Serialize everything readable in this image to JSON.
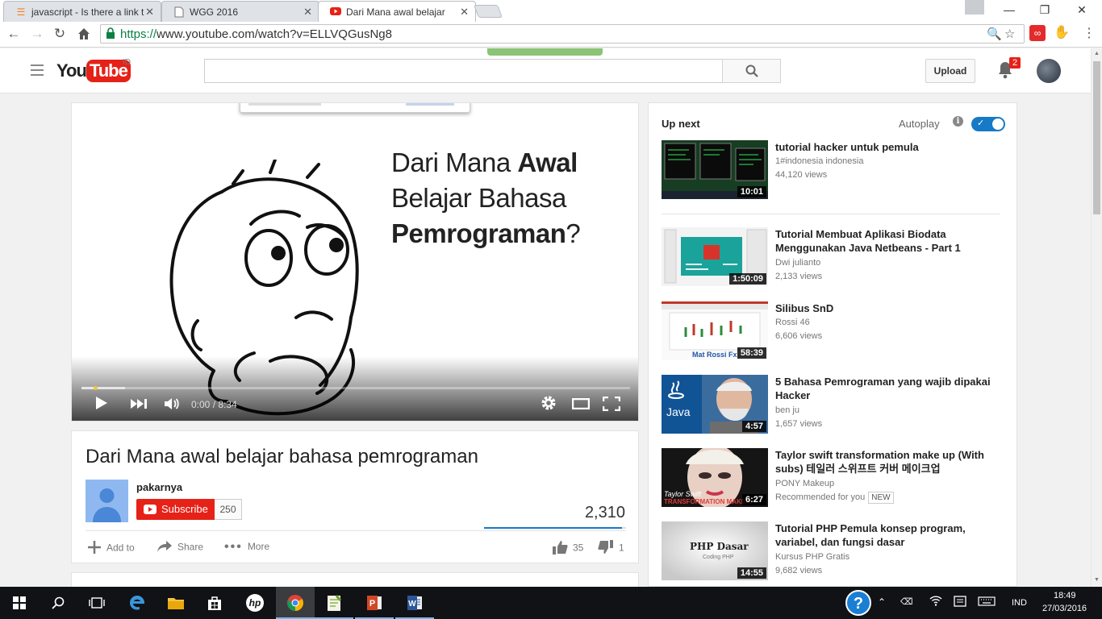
{
  "browser": {
    "tabs": [
      {
        "title": "javascript - Is there a link t",
        "icon": "stackoverflow-icon",
        "active": false
      },
      {
        "title": "WGG 2016",
        "icon": "document-icon",
        "active": false
      },
      {
        "title": "Dari Mana awal belajar",
        "icon": "youtube-icon",
        "active": true
      }
    ],
    "url_scheme": "https://",
    "url_rest": "www.youtube.com/watch?v=ELLVQGusNg8"
  },
  "yt_header": {
    "logo_you": "You",
    "logo_tube": "Tube",
    "region": "ID",
    "search_value": "",
    "upload_label": "Upload",
    "notification_count": "2"
  },
  "player": {
    "slide_line1_normal": "Dari Mana ",
    "slide_line1_bold": "Awal",
    "slide_line2": "Belajar Bahasa",
    "slide_line3_bold": "Pemrograman",
    "slide_line3_end": "?",
    "time": "0:00 / 8:34",
    "progress_fraction": 0.0,
    "loaded_fraction": 0.08
  },
  "video": {
    "title": "Dari Mana awal belajar bahasa pemrograman",
    "channel": "pakarnya",
    "subscribe_label": "Subscribe",
    "subscriber_count": "250",
    "views": "2,310",
    "like_fraction": 0.97,
    "add_to_label": "Add to",
    "share_label": "Share",
    "more_label": "More",
    "likes": "35",
    "dislikes": "1"
  },
  "sidebar": {
    "up_next_label": "Up next",
    "autoplay_label": "Autoplay",
    "autoplay_on": true,
    "items": [
      {
        "title": "tutorial hacker untuk pemula",
        "channel": "1#indonesia indonesia",
        "views": "44,120 views",
        "duration": "10:01"
      },
      {
        "title": "Tutorial Membuat Aplikasi Biodata Menggunakan Java Netbeans - Part 1",
        "channel": "Dwi julianto",
        "views": "2,133 views",
        "duration": "1:50:09"
      },
      {
        "title": "Silibus SnD",
        "channel": "Rossi 46",
        "views": "6,606 views",
        "duration": "58:39",
        "thumb_caption": "Mat Rossi Fx"
      },
      {
        "title": "5 Bahasa Pemrograman yang wajib dipakai Hacker",
        "channel": "ben ju",
        "views": "1,657 views",
        "duration": "4:57",
        "thumb_caption": "Java"
      },
      {
        "title": "Taylor swift transformation make up (With subs) 테일러 스위프트 커버 메이크업",
        "channel": "PONY Makeup",
        "views": "Recommended for you",
        "badge": "NEW",
        "duration": "6:27",
        "thumb_caption": "TRANSFORMATION MAKE-U",
        "thumb_caption2": "Taylor Swift"
      },
      {
        "title": "Tutorial PHP Pemula konsep program, variabel, dan fungsi dasar",
        "channel": "Kursus PHP Gratis",
        "views": "9,682 views",
        "duration": "14:55",
        "thumb_caption": "PHP Dasar",
        "thumb_caption2": "Coding PHP"
      }
    ]
  },
  "taskbar": {
    "language": "IND",
    "time": "18:49",
    "date": "27/03/2016"
  },
  "colors": {
    "youtube_red": "#e62117",
    "accent_blue": "#167ac6",
    "taskbar": "#111216"
  }
}
